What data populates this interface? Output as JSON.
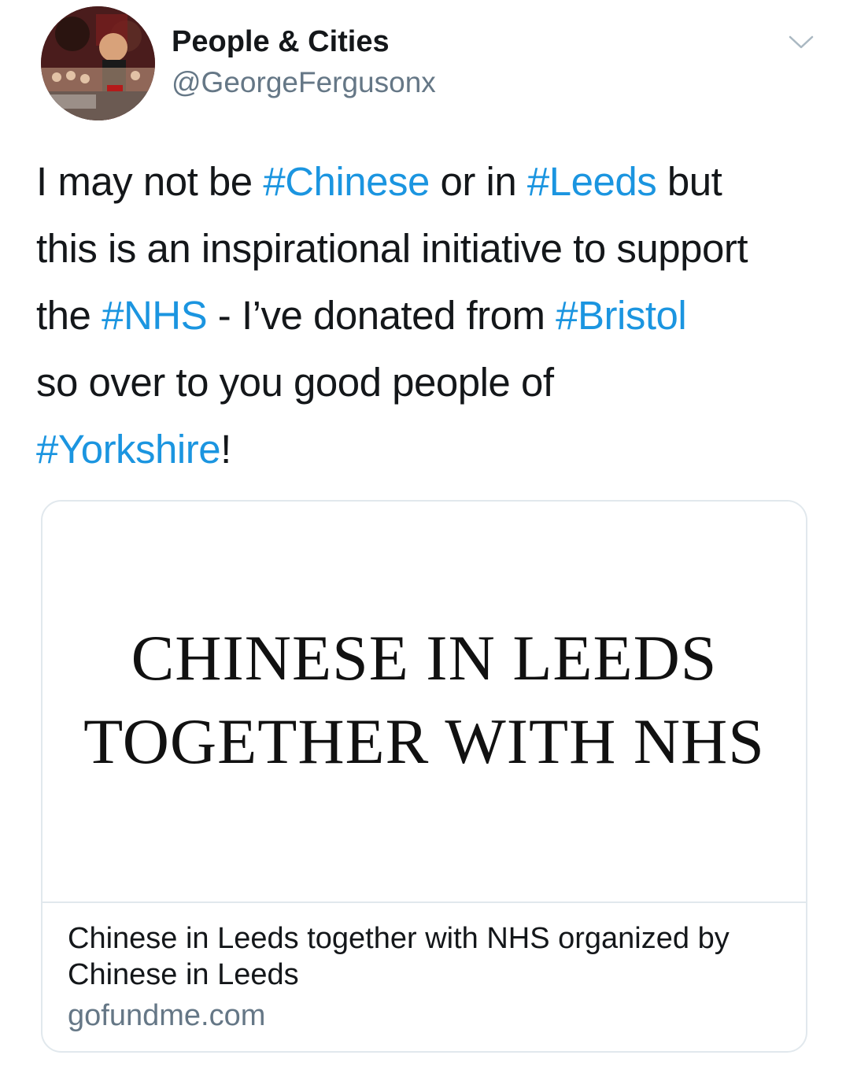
{
  "author": {
    "display_name": "People & Cities",
    "handle": "@GeorgeFergusonx"
  },
  "tweet": {
    "lines": [
      [
        {
          "text": "I may not be ",
          "tag": false
        },
        {
          "text": "#Chinese",
          "tag": true
        },
        {
          "text": " or in ",
          "tag": false
        },
        {
          "text": "#Leeds",
          "tag": true
        },
        {
          "text": " but",
          "tag": false
        }
      ],
      [
        {
          "text": "this is an inspirational initiative to support",
          "tag": false
        }
      ],
      [
        {
          "text": "the ",
          "tag": false
        },
        {
          "text": "#NHS",
          "tag": true
        },
        {
          "text": " - I’ve donated from ",
          "tag": false
        },
        {
          "text": "#Bristol",
          "tag": true
        }
      ],
      [
        {
          "text": "so over to you good people of",
          "tag": false
        }
      ],
      [
        {
          "text": "#Yorkshire",
          "tag": true
        },
        {
          "text": "!",
          "tag": false
        }
      ]
    ]
  },
  "card": {
    "image_line_1": "CHINESE IN LEEDS",
    "image_line_2": "TOGETHER WITH NHS",
    "title": "Chinese in Leeds together with NHS organized by Chinese in Leeds",
    "domain": "gofundme.com"
  },
  "icons": {
    "caret": "chevron-down-icon",
    "avatar": "profile-avatar"
  },
  "colors": {
    "hashtag": "#1b95e0",
    "secondary_text": "#657786",
    "border": "#e1e8ed"
  }
}
